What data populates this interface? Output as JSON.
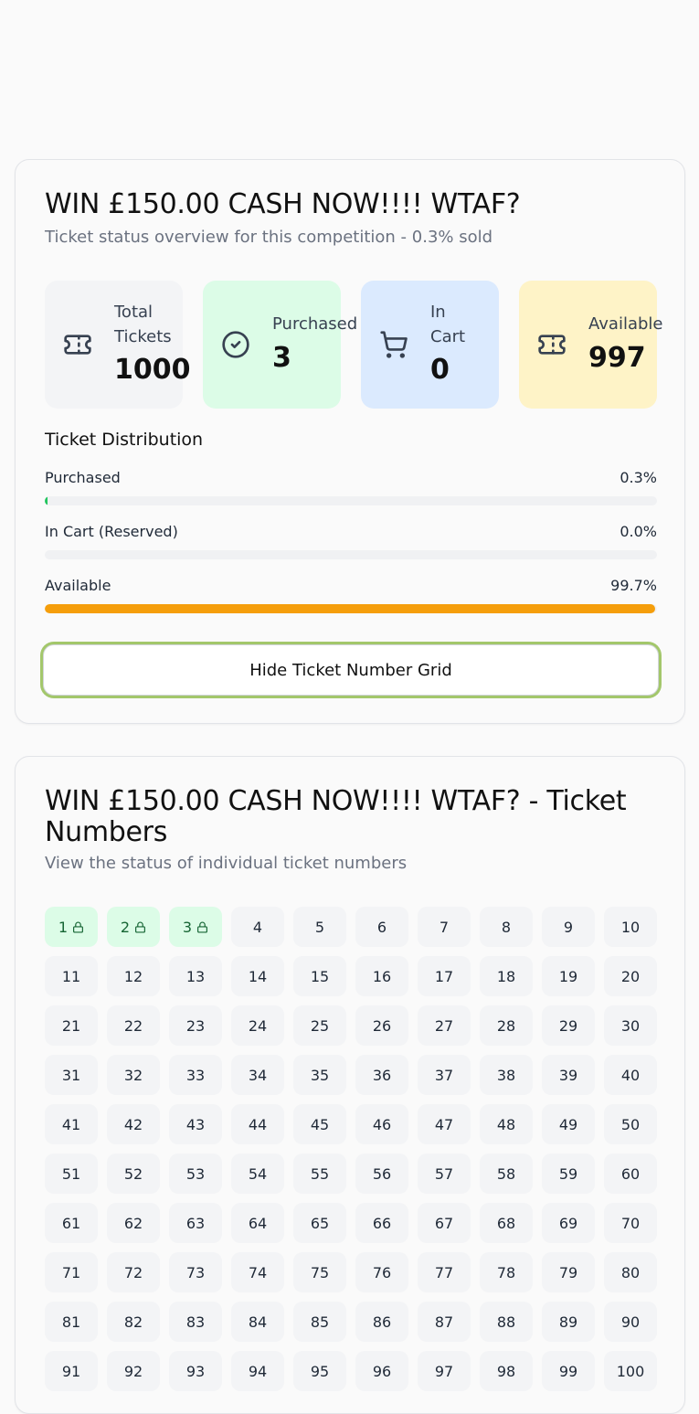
{
  "overview": {
    "title": "WIN £150.00 CASH NOW!!!! WTAF?",
    "subtitle": "Ticket status overview for this competition - 0.3% sold",
    "stats": {
      "total": {
        "label": "Total Tickets",
        "value": "1000",
        "icon": "ticket-icon"
      },
      "purchased": {
        "label": "Purchased",
        "value": "3",
        "icon": "check-circle-icon"
      },
      "cart": {
        "label": "In Cart",
        "value": "0",
        "icon": "cart-icon"
      },
      "available": {
        "label": "Available",
        "value": "997",
        "icon": "ticket-icon"
      }
    },
    "distribution": {
      "title": "Ticket Distribution",
      "rows": [
        {
          "label": "Purchased",
          "percent_text": "0.3%",
          "fraction": 0.003,
          "color": "#22c55e"
        },
        {
          "label": "In Cart (Reserved)",
          "percent_text": "0.0%",
          "fraction": 0.0,
          "color": "#3b82f6"
        },
        {
          "label": "Available",
          "percent_text": "99.7%",
          "fraction": 0.997,
          "color": "#f59e0b"
        }
      ]
    },
    "toggle_button_label": "Hide Ticket Number Grid"
  },
  "grid_section": {
    "title": "WIN £150.00 CASH NOW!!!! WTAF? - Ticket Numbers",
    "subtitle": "View the status of individual ticket numbers",
    "purchased_numbers": [
      1,
      2,
      3
    ],
    "tickets": [
      "1",
      "2",
      "3",
      "4",
      "5",
      "6",
      "7",
      "8",
      "9",
      "10",
      "11",
      "12",
      "13",
      "14",
      "15",
      "16",
      "17",
      "18",
      "19",
      "20",
      "21",
      "22",
      "23",
      "24",
      "25",
      "26",
      "27",
      "28",
      "29",
      "30",
      "31",
      "32",
      "33",
      "34",
      "35",
      "36",
      "37",
      "38",
      "39",
      "40",
      "41",
      "42",
      "43",
      "44",
      "45",
      "46",
      "47",
      "48",
      "49",
      "50",
      "51",
      "52",
      "53",
      "54",
      "55",
      "56",
      "57",
      "58",
      "59",
      "60",
      "61",
      "62",
      "63",
      "64",
      "65",
      "66",
      "67",
      "68",
      "69",
      "70",
      "71",
      "72",
      "73",
      "74",
      "75",
      "76",
      "77",
      "78",
      "79",
      "80",
      "81",
      "82",
      "83",
      "84",
      "85",
      "86",
      "87",
      "88",
      "89",
      "90",
      "91",
      "92",
      "93",
      "94",
      "95",
      "96",
      "97",
      "98",
      "99",
      "100"
    ]
  },
  "colors": {
    "purchased_bg": "#dcfce7",
    "cart_bg": "#dbeafe",
    "available_bg": "#fef3c7",
    "total_bg": "#f3f4f6",
    "focus_ring": "#a3c76b"
  }
}
